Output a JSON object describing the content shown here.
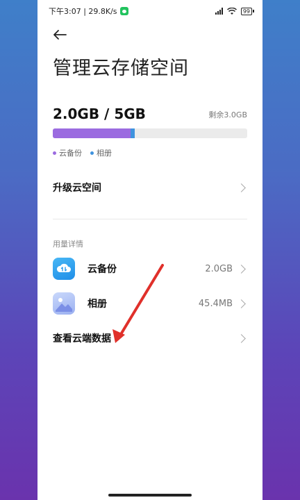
{
  "status_bar": {
    "time_speed": "下午3:07 | 29.8K/s",
    "battery": "99"
  },
  "header": {
    "title": "管理云存储空间"
  },
  "storage": {
    "usage": "2.0GB / 5GB",
    "remaining": "剩余3.0GB",
    "backup_fraction": 0.4,
    "album_fraction": 0.009,
    "legend": [
      {
        "label": "云备份",
        "color": "#9b6be0"
      },
      {
        "label": "相册",
        "color": "#3f93de"
      }
    ]
  },
  "upgrade": {
    "label": "升级云空间"
  },
  "details": {
    "section_label": "用量详情",
    "items": [
      {
        "label": "云备份",
        "value": "2.0GB",
        "icon": "cloud-backup-icon"
      },
      {
        "label": "相册",
        "value": "45.4MB",
        "icon": "album-icon"
      }
    ],
    "view_cloud_data": "查看云端数据"
  },
  "colors": {
    "accent_purple": "#9b6be0",
    "accent_blue": "#3f93de",
    "annotation_arrow": "#e0302a"
  }
}
